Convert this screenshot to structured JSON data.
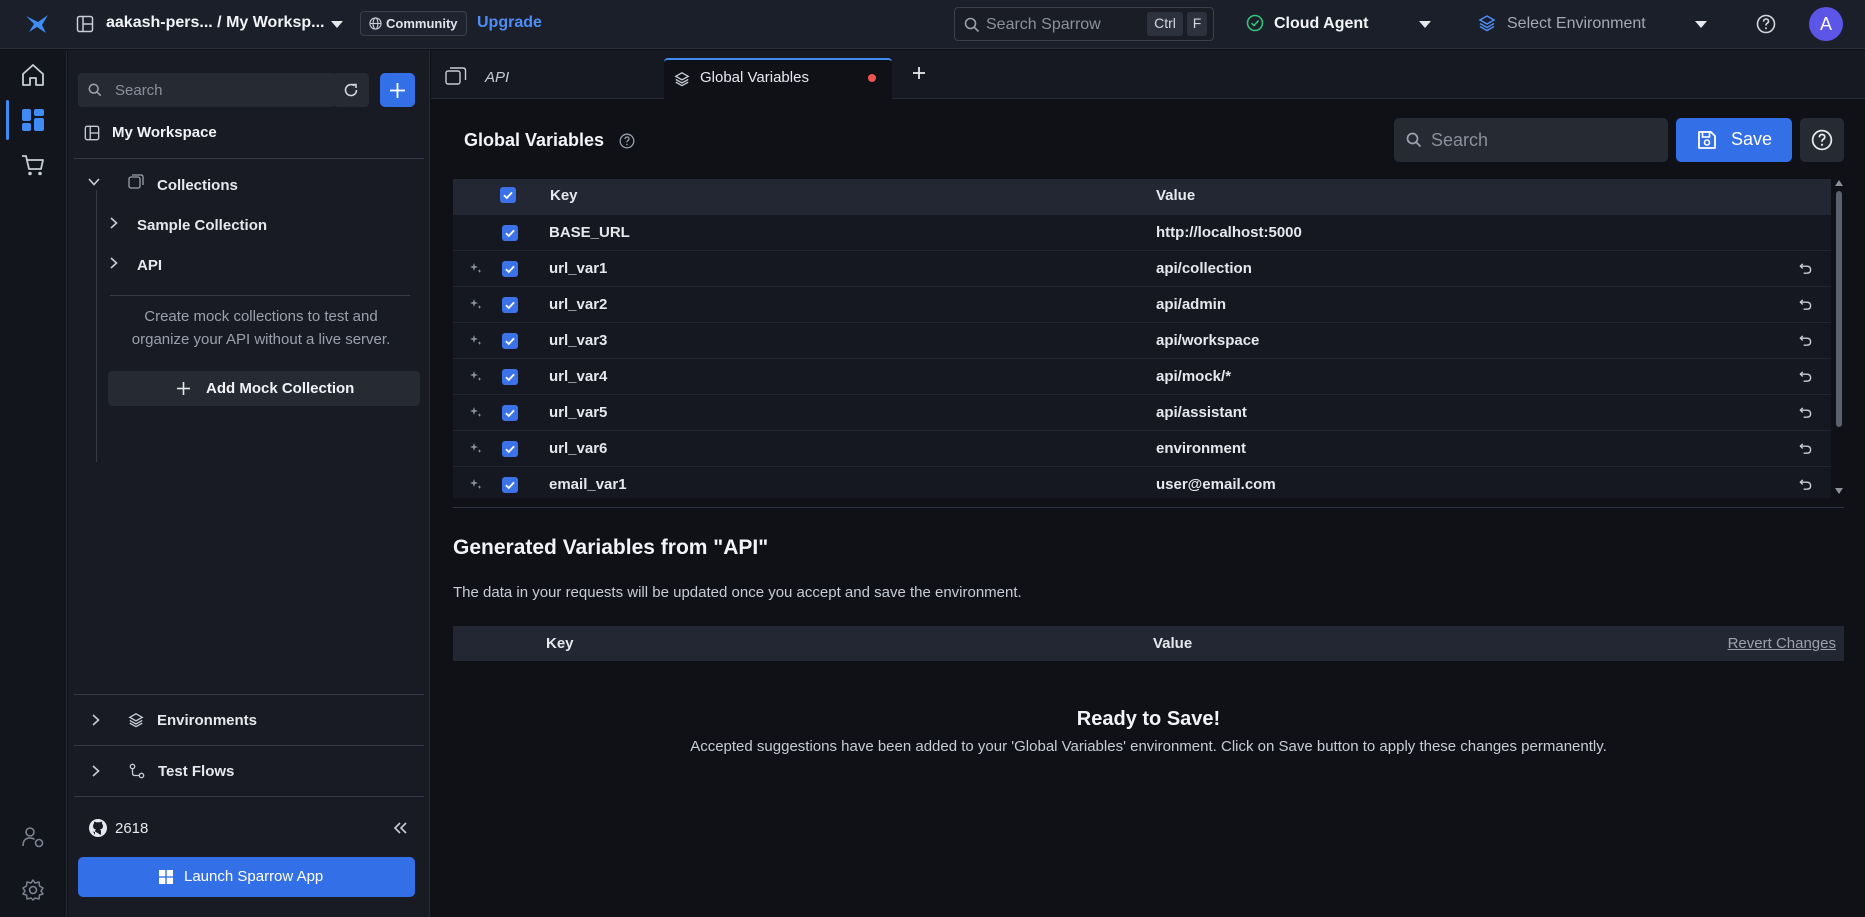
{
  "topbar": {
    "workspace_path": "aakash-pers... / My Worksp...",
    "community_label": "Community",
    "upgrade_label": "Upgrade",
    "search_placeholder": "Search Sparrow",
    "search_key1": "Ctrl",
    "search_key2": "F",
    "agent_label": "Cloud Agent",
    "environment_label": "Select Environment",
    "avatar_letter": "A"
  },
  "sidebar": {
    "search_placeholder": "Search",
    "workspace_label": "My Workspace",
    "collections_label": "Collections",
    "collection_items": [
      "Sample Collection",
      "API"
    ],
    "mock_hint_line1": "Create mock collections to test and",
    "mock_hint_line2": "organize your API without a live server.",
    "add_mock_label": "Add Mock Collection",
    "environments_label": "Environments",
    "testflows_label": "Test Flows",
    "github_stars": "2618",
    "launch_label": "Launch Sparrow App"
  },
  "tabs": [
    {
      "label": "API"
    },
    {
      "label": "Global Variables"
    }
  ],
  "globals": {
    "title": "Global Variables",
    "search_placeholder": "Search",
    "save_label": "Save",
    "col_key": "Key",
    "col_value": "Value",
    "rows": [
      {
        "key": "BASE_URL",
        "value": "http://localhost:5000"
      },
      {
        "key": "url_var1",
        "value": "api/collection"
      },
      {
        "key": "url_var2",
        "value": "api/admin"
      },
      {
        "key": "url_var3",
        "value": "api/workspace"
      },
      {
        "key": "url_var4",
        "value": "api/mock/*"
      },
      {
        "key": "url_var5",
        "value": "api/assistant"
      },
      {
        "key": "url_var6",
        "value": "environment"
      },
      {
        "key": "email_var1",
        "value": "user@email.com"
      }
    ]
  },
  "generated": {
    "title": "Generated Variables from \"API\"",
    "description": "The data in your requests will be updated once you accept and save the environment.",
    "col_key": "Key",
    "col_value": "Value",
    "revert_label": "Revert Changes",
    "ready_title": "Ready to Save!",
    "ready_desc": "Accepted suggestions have been added to your 'Global Variables' environment. Click on Save button to apply these changes permanently."
  }
}
